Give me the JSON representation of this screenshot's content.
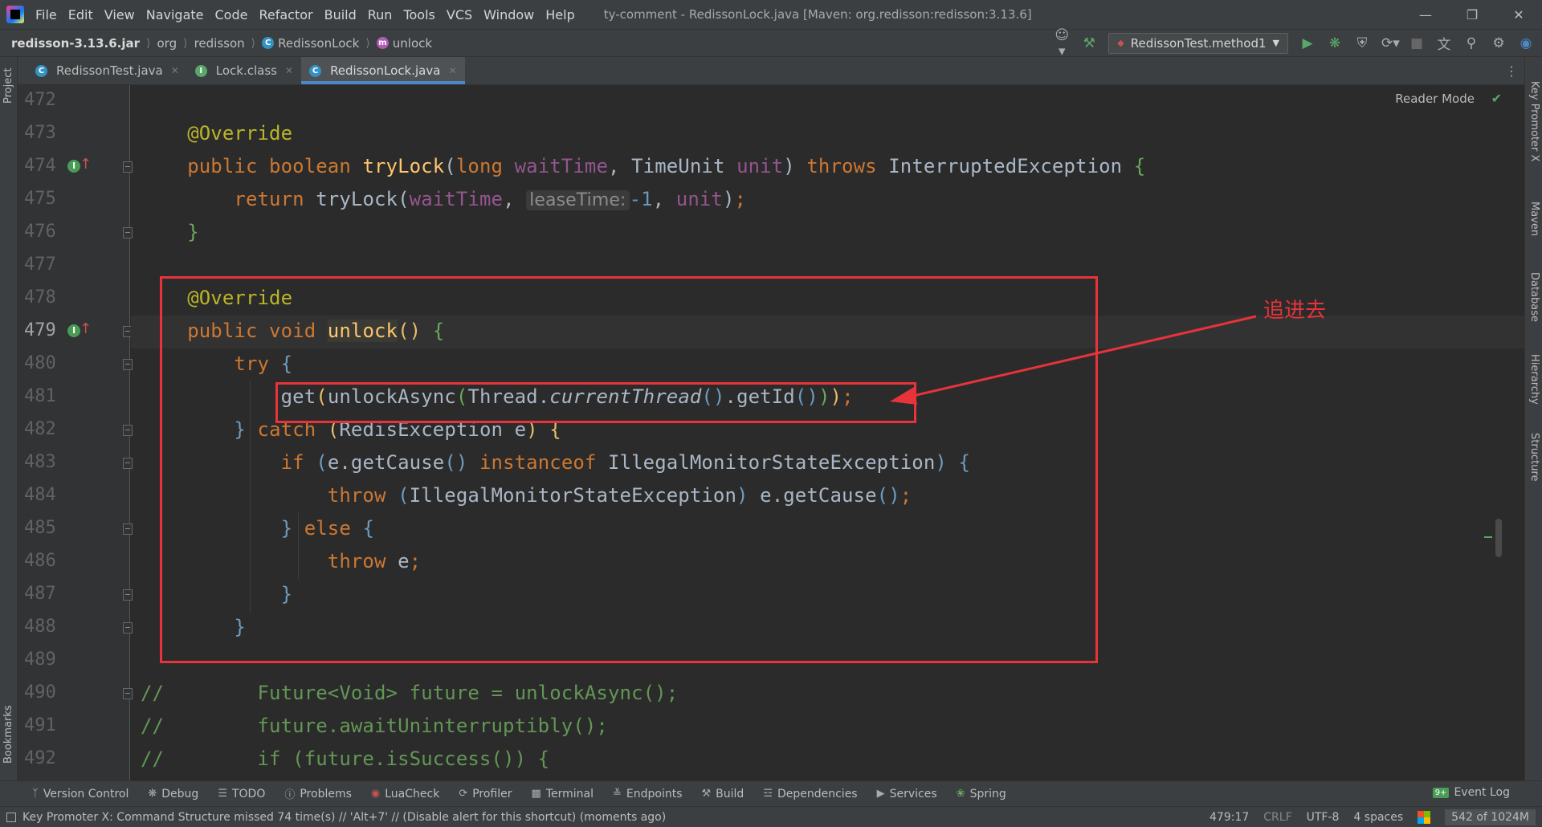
{
  "menubar": {
    "items": [
      "File",
      "Edit",
      "View",
      "Navigate",
      "Code",
      "Refactor",
      "Build",
      "Run",
      "Tools",
      "VCS",
      "Window",
      "Help"
    ],
    "window_title": "ty-comment - RedissonLock.java [Maven: org.redisson:redisson:3.13.6]"
  },
  "breadcrumb": {
    "jar": "redisson-3.13.6.jar",
    "pkg1": "org",
    "pkg2": "redisson",
    "class": "RedissonLock",
    "method": "unlock"
  },
  "toolbar": {
    "run_config": "RedissonTest.method1"
  },
  "tabs": [
    {
      "label": "RedissonTest.java"
    },
    {
      "label": "Lock.class"
    },
    {
      "label": "RedissonLock.java"
    }
  ],
  "editor": {
    "reader_mode": "Reader Mode",
    "line_numbers": [
      "472",
      "473",
      "474",
      "475",
      "476",
      "477",
      "478",
      "479",
      "480",
      "481",
      "482",
      "483",
      "484",
      "485",
      "486",
      "487",
      "488",
      "489",
      "490",
      "491",
      "492"
    ],
    "hint_lease_time": "leaseTime:",
    "annotation_text": "追进去"
  },
  "left_strip": {
    "project": "Project",
    "bookmarks": "Bookmarks"
  },
  "right_strip": {
    "key_promoter": "Key Promoter X",
    "maven": "Maven",
    "database": "Database",
    "hierarchy": "Hierarchy",
    "structure": "Structure"
  },
  "bottom_tools": {
    "version_control": "Version Control",
    "debug": "Debug",
    "todo": "TODO",
    "problems": "Problems",
    "luacheck": "LuaCheck",
    "profiler": "Profiler",
    "terminal": "Terminal",
    "endpoints": "Endpoints",
    "build": "Build",
    "dependencies": "Dependencies",
    "services": "Services",
    "spring": "Spring",
    "event_log": "Event Log",
    "event_badge": "9+"
  },
  "statusbar": {
    "message": "Key Promoter X: Command Structure missed 74 time(s) // 'Alt+7' // (Disable alert for this shortcut) (moments ago)",
    "position": "479:17",
    "line_sep": "CRLF",
    "encoding": "UTF-8",
    "indent": "4 spaces",
    "memory": "542 of 1024M"
  },
  "colors": {
    "accent_tab": "#4a88c7",
    "annotation_red": "#e8333a",
    "keyword": "#cc7832",
    "annotation": "#bbb529",
    "function": "#ffc66d",
    "parameter": "#94558d",
    "comment": "#629755"
  }
}
